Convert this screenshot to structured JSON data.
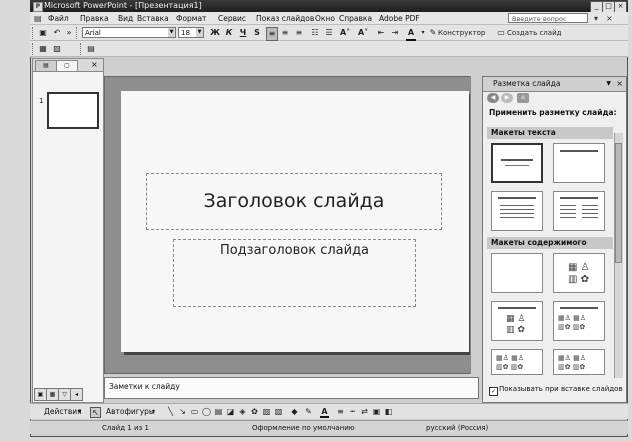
{
  "window": {
    "title": "Microsoft PowerPoint - [Презентация1]",
    "controls": [
      "_",
      "□",
      "×"
    ]
  },
  "menubar": {
    "items": [
      "Файл",
      "Правка",
      "Вид",
      "Вставка",
      "Формат",
      "Сервис",
      "Показ слайдов",
      "Окно",
      "Справка",
      "Adobe PDF"
    ],
    "help_placeholder": "Введите вопрос"
  },
  "formatting_toolbar": {
    "font_name": "Arial",
    "font_size": "18",
    "bold": "Ж",
    "italic": "К",
    "underline": "Ч",
    "shadow": "S",
    "font_color_letter": "А",
    "designer_label": "Конструктор",
    "new_slide_label": "Создать слайд"
  },
  "left_pane": {
    "slide_number": "1"
  },
  "slide": {
    "title_placeholder": "Заголовок слайда",
    "subtitle_placeholder": "Подзаголовок слайда"
  },
  "notes": {
    "placeholder": "Заметки к слайду"
  },
  "task_pane": {
    "title": "Разметка слайда",
    "apply_label": "Применить разметку слайда:",
    "section_text": "Макеты текста",
    "section_content": "Макеты содержимого",
    "show_on_insert": "Показывать при вставке слайдов"
  },
  "drawing_toolbar": {
    "actions_label": "Действия",
    "autoshapes_label": "Автофигуры"
  },
  "statusbar": {
    "slide_info": "Слайд 1 из 1",
    "design": "Оформление по умолчанию",
    "language": "русский (Россия)"
  }
}
